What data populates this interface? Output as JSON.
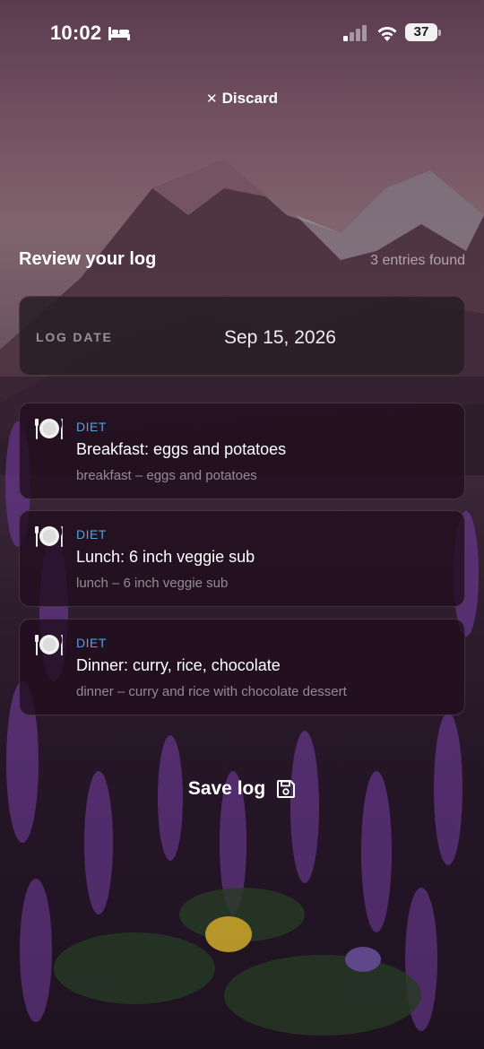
{
  "status_bar": {
    "time": "10:02",
    "battery_level": "37",
    "icons": [
      "bed-icon",
      "cellular-signal-icon",
      "wifi-icon",
      "battery-icon"
    ]
  },
  "discard": {
    "icon": "close-icon",
    "label": "Discard"
  },
  "review": {
    "title": "Review your log",
    "entries_count": "3 entries found"
  },
  "log_date": {
    "label": "LOG DATE",
    "value": "Sep 15, 2026"
  },
  "entries": [
    {
      "icon": "plate-icon",
      "category": "DIET",
      "title": "Breakfast: eggs and potatoes",
      "detail": "breakfast – eggs and potatoes"
    },
    {
      "icon": "plate-icon",
      "category": "DIET",
      "title": "Lunch: 6 inch veggie sub",
      "detail": "lunch – 6 inch veggie sub"
    },
    {
      "icon": "plate-icon",
      "category": "DIET",
      "title": "Dinner: curry, rice, chocolate",
      "detail": "dinner – curry and rice with chocolate dessert"
    }
  ],
  "save": {
    "label": "Save log",
    "icon": "floppy-disk-icon"
  },
  "colors": {
    "category_accent": "#4fa3e0",
    "card_background": "#200e1e",
    "text_primary": "#ffffff"
  }
}
